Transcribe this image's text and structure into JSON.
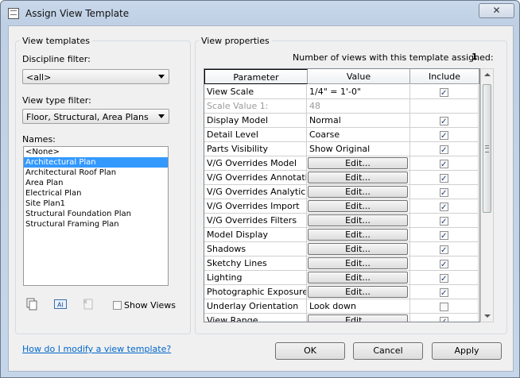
{
  "window": {
    "title": "Assign View Template",
    "close_glyph": "✕"
  },
  "view_templates": {
    "group_title": "View templates",
    "discipline_label": "Discipline filter:",
    "discipline_value": "<all>",
    "viewtype_label": "View type filter:",
    "viewtype_value": "Floor, Structural, Area Plans",
    "names_label": "Names:",
    "names": [
      {
        "label": "<None>",
        "selected": false
      },
      {
        "label": "Architectural Plan",
        "selected": true
      },
      {
        "label": "Architectural Roof Plan",
        "selected": false
      },
      {
        "label": "Area Plan",
        "selected": false
      },
      {
        "label": "Electrical Plan",
        "selected": false
      },
      {
        "label": "Site Plan1",
        "selected": false
      },
      {
        "label": "Structural Foundation Plan",
        "selected": false
      },
      {
        "label": "Structural Framing Plan",
        "selected": false
      }
    ],
    "show_views_label": "Show Views"
  },
  "view_properties": {
    "group_title": "View properties",
    "count_label": "Number of views with this template assigned:",
    "count_value": "1",
    "columns": {
      "parameter": "Parameter",
      "value": "Value",
      "include": "Include"
    },
    "edit_label": "Edit...",
    "rows": [
      {
        "parameter": "View Scale",
        "value": "1/4\" = 1'-0\"",
        "button": false,
        "include": true,
        "dim": false
      },
      {
        "parameter": "Scale Value    1:",
        "value": "48",
        "button": false,
        "include": null,
        "dim": true
      },
      {
        "parameter": "Display Model",
        "value": "Normal",
        "button": false,
        "include": true,
        "dim": false
      },
      {
        "parameter": "Detail Level",
        "value": "Coarse",
        "button": false,
        "include": true,
        "dim": false
      },
      {
        "parameter": "Parts Visibility",
        "value": "Show Original",
        "button": false,
        "include": true,
        "dim": false
      },
      {
        "parameter": "V/G Overrides Model",
        "value": "",
        "button": true,
        "include": true,
        "dim": false
      },
      {
        "parameter": "V/G Overrides Annotati",
        "value": "",
        "button": true,
        "include": true,
        "dim": false
      },
      {
        "parameter": "V/G Overrides Analytica",
        "value": "",
        "button": true,
        "include": true,
        "dim": false
      },
      {
        "parameter": "V/G Overrides Import",
        "value": "",
        "button": true,
        "include": true,
        "dim": false
      },
      {
        "parameter": "V/G Overrides Filters",
        "value": "",
        "button": true,
        "include": true,
        "dim": false
      },
      {
        "parameter": "Model Display",
        "value": "",
        "button": true,
        "include": true,
        "dim": false
      },
      {
        "parameter": "Shadows",
        "value": "",
        "button": true,
        "include": true,
        "dim": false
      },
      {
        "parameter": "Sketchy Lines",
        "value": "",
        "button": true,
        "include": true,
        "dim": false
      },
      {
        "parameter": "Lighting",
        "value": "",
        "button": true,
        "include": true,
        "dim": false
      },
      {
        "parameter": "Photographic Exposure",
        "value": "",
        "button": true,
        "include": true,
        "dim": false
      },
      {
        "parameter": "Underlay Orientation",
        "value": "Look down",
        "button": false,
        "include": false,
        "dim": false
      },
      {
        "parameter": "View Range",
        "value": "",
        "button": true,
        "include": true,
        "dim": false
      }
    ]
  },
  "footer": {
    "help_link": "How do I modify a view template?",
    "ok": "OK",
    "cancel": "Cancel",
    "apply": "Apply"
  }
}
